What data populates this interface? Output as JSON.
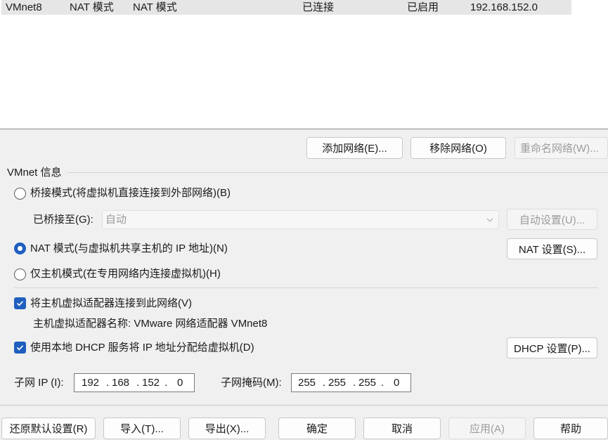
{
  "network_list": {
    "rows": [
      {
        "name": "VMnet8",
        "type": "NAT 模式",
        "external": "NAT 模式",
        "host_connection": "已连接",
        "dhcp": "已启用",
        "subnet": "192.168.152.0"
      }
    ]
  },
  "list_buttons": {
    "add": "添加网络(E)...",
    "remove": "移除网络(O)",
    "rename": "重命名网络(W)..."
  },
  "info": {
    "group_title": "VMnet 信息",
    "bridged_label": "桥接模式(将虚拟机直接连接到外部网络)(B)",
    "bridged_to_label": "已桥接至(G):",
    "bridged_to_value": "自动",
    "auto_settings": "自动设置(U)...",
    "nat_label": "NAT 模式(与虚拟机共享主机的 IP 地址)(N)",
    "nat_settings": "NAT 设置(S)...",
    "hostonly_label": "仅主机模式(在专用网络内连接虚拟机)(H)",
    "connect_adapter_label": "将主机虚拟适配器连接到此网络(V)",
    "adapter_name_text": "主机虚拟适配器名称: VMware 网络适配器 VMnet8",
    "dhcp_label": "使用本地 DHCP 服务将 IP 地址分配给虚拟机(D)",
    "dhcp_settings": "DHCP 设置(P)...",
    "subnet_ip_label": "子网 IP (I):",
    "subnet_ip": [
      "192",
      "168",
      "152",
      "0"
    ],
    "subnet_mask_label": "子网掩码(M):",
    "subnet_mask": [
      "255",
      "255",
      "255",
      "0"
    ],
    "ip_separator": "."
  },
  "footer": {
    "restore": "还原默认设置(R)",
    "import": "导入(T)...",
    "export": "导出(X)...",
    "ok": "确定",
    "cancel": "取消",
    "apply": "应用(A)",
    "help": "帮助"
  },
  "colors": {
    "accent": "#1f5fbf",
    "selected_row": "#e6e6e6",
    "disabled_text": "#9c9c9c"
  }
}
